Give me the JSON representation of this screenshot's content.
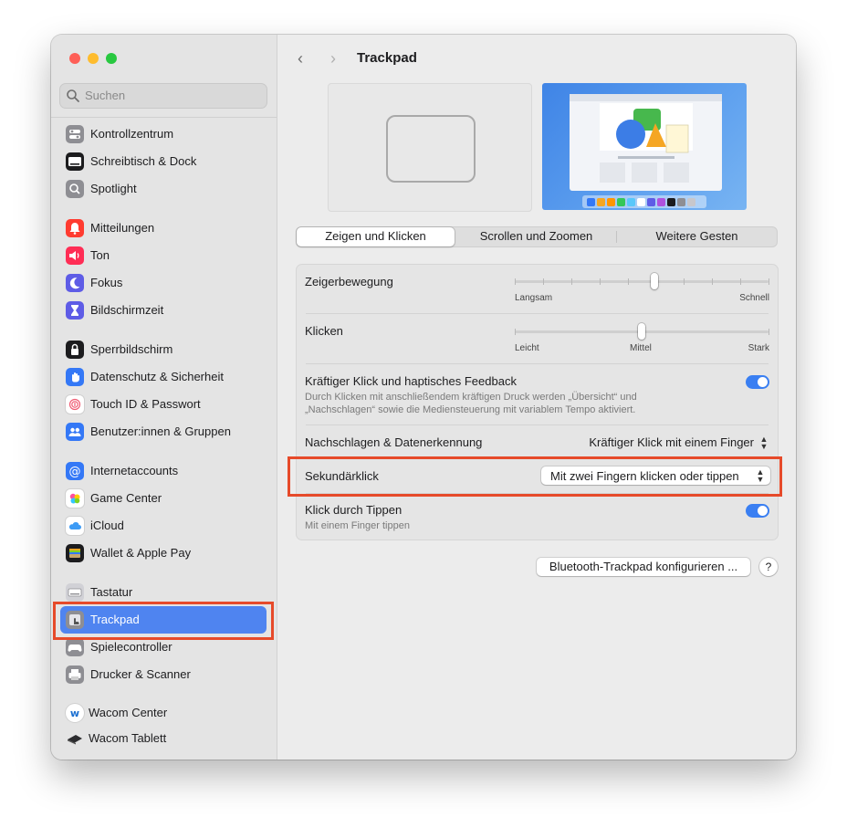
{
  "window": {
    "title": "Trackpad",
    "colors": {
      "close": "#fe5f57",
      "minimize": "#febc2e",
      "zoom": "#28c840",
      "accent": "#3a7ff2",
      "highlight": "#e64a2a"
    }
  },
  "sidebar": {
    "search_placeholder": "Suchen",
    "items": [
      {
        "label": "Kontrollzentrum",
        "icon": "control-center-icon",
        "color": "#8e8e93"
      },
      {
        "label": "Schreibtisch & Dock",
        "icon": "desktop-dock-icon",
        "color": "#1c1c1e"
      },
      {
        "label": "Spotlight",
        "icon": "spotlight-icon",
        "color": "#8e8e93"
      },
      {
        "label": "Mitteilungen",
        "icon": "notifications-icon",
        "color": "#ff3b30"
      },
      {
        "label": "Ton",
        "icon": "sound-icon",
        "color": "#ff2d55"
      },
      {
        "label": "Fokus",
        "icon": "focus-moon-icon",
        "color": "#5e5ce6"
      },
      {
        "label": "Bildschirmzeit",
        "icon": "screen-time-icon",
        "color": "#5e5ce6"
      },
      {
        "label": "Sperrbildschirm",
        "icon": "lock-screen-icon",
        "color": "#1c1c1e"
      },
      {
        "label": "Datenschutz & Sicherheit",
        "icon": "privacy-hand-icon",
        "color": "#3478f6"
      },
      {
        "label": "Touch ID & Passwort",
        "icon": "touch-id-icon",
        "color": "#ffffff"
      },
      {
        "label": "Benutzer:innen & Gruppen",
        "icon": "users-groups-icon",
        "color": "#3478f6"
      },
      {
        "label": "Internetaccounts",
        "icon": "internet-accounts-icon",
        "color": "#3478f6"
      },
      {
        "label": "Game Center",
        "icon": "game-center-icon",
        "color": "#ffffff"
      },
      {
        "label": "iCloud",
        "icon": "icloud-icon",
        "color": "#ffffff"
      },
      {
        "label": "Wallet & Apple Pay",
        "icon": "wallet-icon",
        "color": "#1c1c1e"
      },
      {
        "label": "Tastatur",
        "icon": "keyboard-icon",
        "color": "#c7c7cc"
      },
      {
        "label": "Trackpad",
        "icon": "trackpad-icon",
        "color": "#8e8e93",
        "active": true
      },
      {
        "label": "Spielecontroller",
        "icon": "game-controller-icon",
        "color": "#8e8e93"
      },
      {
        "label": "Drucker & Scanner",
        "icon": "printer-icon",
        "color": "#8e8e93"
      },
      {
        "label": "Wacom Center",
        "icon": "wacom-center-icon",
        "color": "#ffffff"
      },
      {
        "label": "Wacom Tablett",
        "icon": "wacom-tablet-icon",
        "color": "#2c2c2e"
      }
    ]
  },
  "header": {
    "back_glyph": "‹",
    "forward_glyph": "›"
  },
  "tabs": [
    {
      "label": "Zeigen und Klicken",
      "selected": true
    },
    {
      "label": "Scrollen und Zoomen",
      "selected": false
    },
    {
      "label": "Weitere Gesten",
      "selected": false
    }
  ],
  "settings": {
    "pointer_speed": {
      "label": "Zeigerbewegung",
      "min_label": "Langsam",
      "max_label": "Schnell",
      "value_fraction": 0.55,
      "ticks": 10
    },
    "click": {
      "label": "Klicken",
      "min_label": "Leicht",
      "mid_label": "Mittel",
      "max_label": "Stark",
      "value_fraction": 0.5,
      "ticks": 3
    },
    "force_click": {
      "label": "Kräftiger Klick und haptisches Feedback",
      "description_line1": "Durch Klicken mit anschließendem kräftigen Druck werden „Übersicht“ und",
      "description_line2": "„Nachschlagen“ sowie die Mediensteuerung mit variablem Tempo aktiviert.",
      "enabled": true
    },
    "lookup": {
      "label": "Nachschlagen & Datenerkennung",
      "value": "Kräftiger Klick mit einem Finger"
    },
    "secondary_click": {
      "label": "Sekundärklick",
      "value": "Mit zwei Fingern klicken oder tippen"
    },
    "tap_to_click": {
      "label": "Klick durch Tippen",
      "description": "Mit einem Finger tippen",
      "enabled": true
    }
  },
  "footer": {
    "bluetooth_button": "Bluetooth-Trackpad konfigurieren ...",
    "help_label": "?"
  }
}
